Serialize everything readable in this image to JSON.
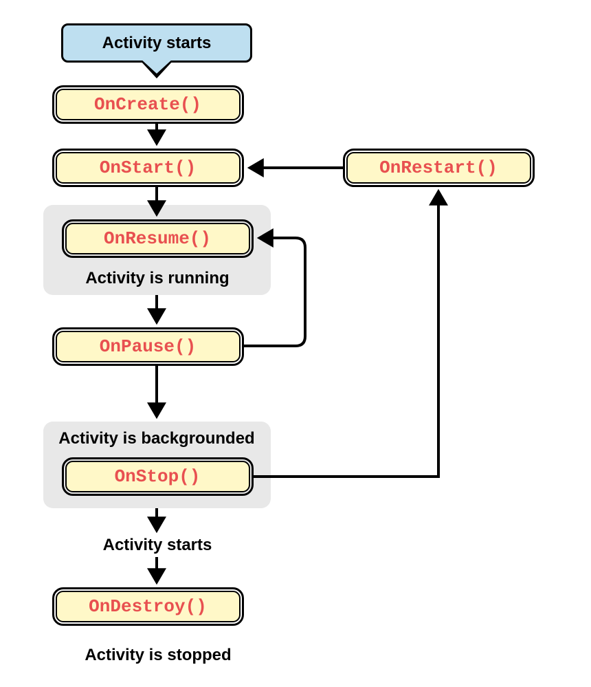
{
  "start": {
    "label": "Activity starts"
  },
  "methods": {
    "onCreate": "OnCreate()",
    "onStart": "OnStart()",
    "onResume": "OnResume()",
    "onPause": "OnPause()",
    "onStop": "OnStop()",
    "onDestroy": "OnDestroy()",
    "onRestart": "OnRestart()"
  },
  "captions": {
    "running": "Activity is running",
    "backgrounded": "Activity is backgrounded",
    "starts": "Activity starts",
    "stopped": "Activity is stopped"
  },
  "colors": {
    "start_fill": "#bedff0",
    "method_fill": "#fff8c8",
    "method_text": "#e85050",
    "gray_fill": "#e8e8e8",
    "line": "#000000"
  },
  "flow": {
    "edges": [
      {
        "from": "start_node",
        "to": "onCreate"
      },
      {
        "from": "onCreate",
        "to": "onStart"
      },
      {
        "from": "onStart",
        "to": "onResume"
      },
      {
        "from": "onResume",
        "to": "onPause",
        "note": "Activity is running"
      },
      {
        "from": "onPause",
        "to": "onResume",
        "note": "loop back"
      },
      {
        "from": "onPause",
        "to": "onStop",
        "note": "Activity is backgrounded"
      },
      {
        "from": "onStop",
        "to": "onDestroy",
        "note": "Activity starts"
      },
      {
        "from": "onStop",
        "to": "onRestart"
      },
      {
        "from": "onRestart",
        "to": "onStart"
      },
      {
        "from": "onDestroy",
        "to": "stopped_label",
        "note": "Activity is stopped"
      }
    ]
  }
}
